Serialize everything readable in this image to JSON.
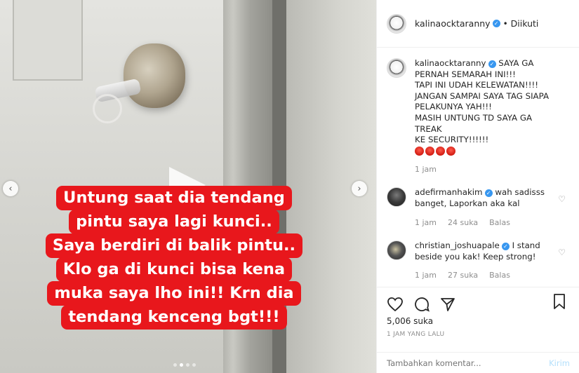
{
  "post": {
    "username": "kalinaocktaranny",
    "follow_status": "Diikuti",
    "separator": "•"
  },
  "media": {
    "caption_lines": [
      "Untung saat dia tendang",
      "pintu saya lagi kunci..",
      "Saya berdiri di balik pintu..",
      "Klo ga di kunci bisa kena",
      "muka saya lho ini!! Krn dia",
      "tendang kenceng bgt!!!"
    ],
    "nav_left": "‹",
    "nav_right": "›",
    "carousel_index": 2,
    "carousel_total": 4
  },
  "caption_comment": {
    "username": "kalinaocktaranny",
    "lines": [
      "SAYA GA",
      "PERNAH SEMARAH INI!!!",
      "TAPI INI UDAH KELEWATAN!!!!",
      "JANGAN SAMPAI SAYA TAG SIAPA",
      "PELAKUNYA YAH!!!",
      "MASIH UNTUNG TD SAYA GA TREAK",
      "KE SECURITY!!!!!!"
    ],
    "time": "1 jam",
    "emoji_icon": "angry-face-icon"
  },
  "comments": [
    {
      "username": "adefirmanhakim",
      "text_first": "wah sadisss",
      "text_rest": "banget, Laporkan aka kal",
      "time": "1 jam",
      "likes": "24 suka",
      "reply": "Balas"
    },
    {
      "username": "christian_joshuapale",
      "text_first": "I stand",
      "text_rest": "beside you kak! Keep strong!",
      "time": "1 jam",
      "likes": "27 suka",
      "reply": "Balas"
    }
  ],
  "stats": {
    "likes": "5,006 suka",
    "posted_ago": "1 JAM YANG LALU"
  },
  "add_comment": {
    "placeholder": "Tambahkan komentar...",
    "send_label": "Kirim"
  },
  "colors": {
    "caption_bg": "#e8171c",
    "verified": "#3897f0",
    "muted": "#8e8e8e",
    "send_disabled": "#b2dffc"
  }
}
